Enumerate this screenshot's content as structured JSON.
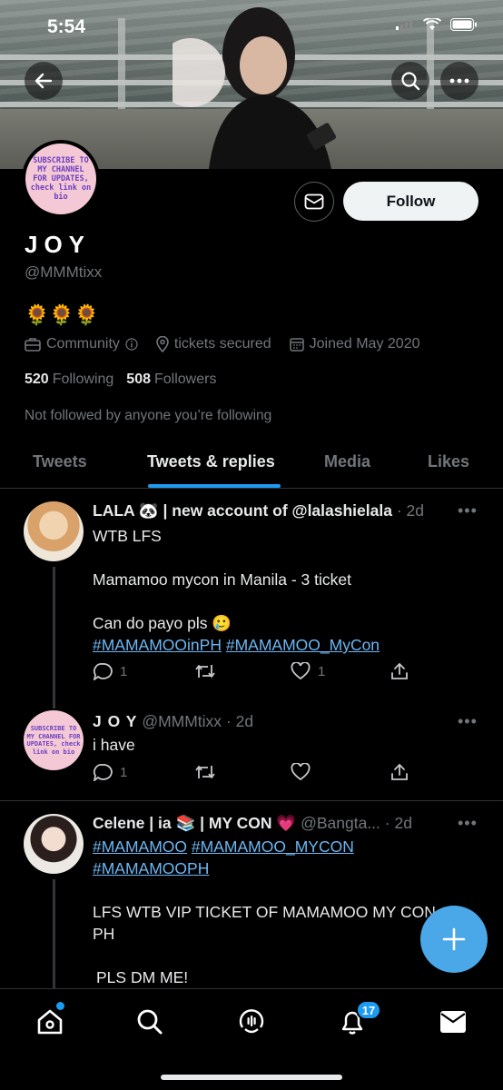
{
  "status": {
    "time": "5:54"
  },
  "profile": {
    "avatar_text": "SUBSCRIBE TO MY CHANNEL FOR UPDATES, check link on bio",
    "display_name": "JOY",
    "handle": "@MMMtixx",
    "bio": "🌻🌻🌻",
    "category": "Community",
    "location": "tickets secured",
    "joined": "Joined May 2020",
    "following_count": "520",
    "following_label": "Following",
    "followers_count": "508",
    "followers_label": "Followers",
    "not_followed_text": "Not followed by anyone you’re following",
    "follow_label": "Follow"
  },
  "tabs": [
    {
      "label": "Tweets",
      "active": false
    },
    {
      "label": "Tweets & replies",
      "active": true
    },
    {
      "label": "Media",
      "active": false
    },
    {
      "label": "Likes",
      "active": false
    }
  ],
  "tweets": [
    {
      "name": "LALA 🐼 | new account of @lalashielala",
      "handle": "",
      "time": "· 2d",
      "line1": "WTB LFS",
      "line2": "Mamamoo mycon in Manila - 3 ticket",
      "line3": "Can do payo pls 🥲",
      "tag1": "#MAMAMOOinPH",
      "tag2": "#MAMAMOO_MyCon",
      "replies": "1",
      "retweets": "",
      "likes": "1"
    },
    {
      "name": "J O Y",
      "handle": "@MMMtixx",
      "time": "· 2d",
      "line1": "i have",
      "replies": "1",
      "retweets": "",
      "likes": ""
    },
    {
      "name": "Celene | ia 📚 | MY CON 💗",
      "handle": "@Bangta...",
      "time": "· 2d",
      "tag1": "#MAMAMOO",
      "tag2": "#MAMAMOO_MYCON",
      "tag3": "#MAMAMOOPH",
      "line1": "LFS WTB VIP TICKET OF MAMAMOO MY CON",
      "line1b": "PH",
      "line2": "PLS DM ME!"
    }
  ],
  "nav": {
    "notifications_badge": "17"
  },
  "colors": {
    "accent": "#1d9bf0",
    "link": "#6cb7f3",
    "fab": "#4aa8e8"
  }
}
